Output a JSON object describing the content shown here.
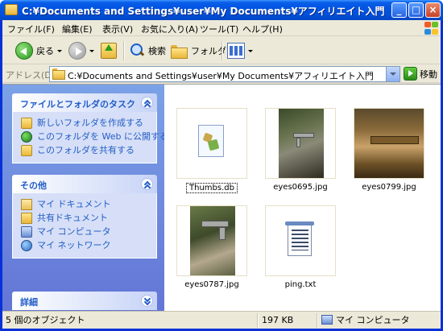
{
  "window": {
    "title": "C:¥Documents and Settings¥user¥My Documents¥アフィリエイト入門",
    "minimize": "_",
    "maximize": "□",
    "close": "×"
  },
  "menu": {
    "items": [
      "ファイル(F)",
      "編集(E)",
      "表示(V)",
      "お気に入り(A)",
      "ツール(T)",
      "ヘルプ(H)"
    ]
  },
  "toolbar": {
    "back_label": "戻る",
    "search_label": "検索",
    "folders_label": "フォルダ"
  },
  "address": {
    "label": "アドレス(D)",
    "value": "C:¥Documents and Settings¥user¥My Documents¥アフィリエイト入門",
    "go_label": "移動"
  },
  "taskpane": {
    "file_tasks": {
      "title": "ファイルとフォルダのタスク",
      "items": [
        "新しいフォルダを作成する",
        "このフォルダを Web に公開する",
        "このフォルダを共有する"
      ]
    },
    "other_places": {
      "title": "その他",
      "items": [
        "マイ ドキュメント",
        "共有ドキュメント",
        "マイ コンピュータ",
        "マイ ネットワーク"
      ]
    },
    "details": {
      "title": "詳細"
    }
  },
  "files": [
    {
      "name": "Thumbs.db",
      "type": "db"
    },
    {
      "name": "eyes0695.jpg",
      "type": "image"
    },
    {
      "name": "eyes0799.jpg",
      "type": "image"
    },
    {
      "name": "eyes0787.jpg",
      "type": "image"
    },
    {
      "name": "ping.txt",
      "type": "text"
    }
  ],
  "status": {
    "objects": "5 個のオブジェクト",
    "size": "197 KB",
    "location": "マイ コンピュータ"
  },
  "colors": {
    "titlebar": "#0054e3",
    "taskpane_link": "#215dc6",
    "taskpane_bg": "#7ba2e7"
  }
}
